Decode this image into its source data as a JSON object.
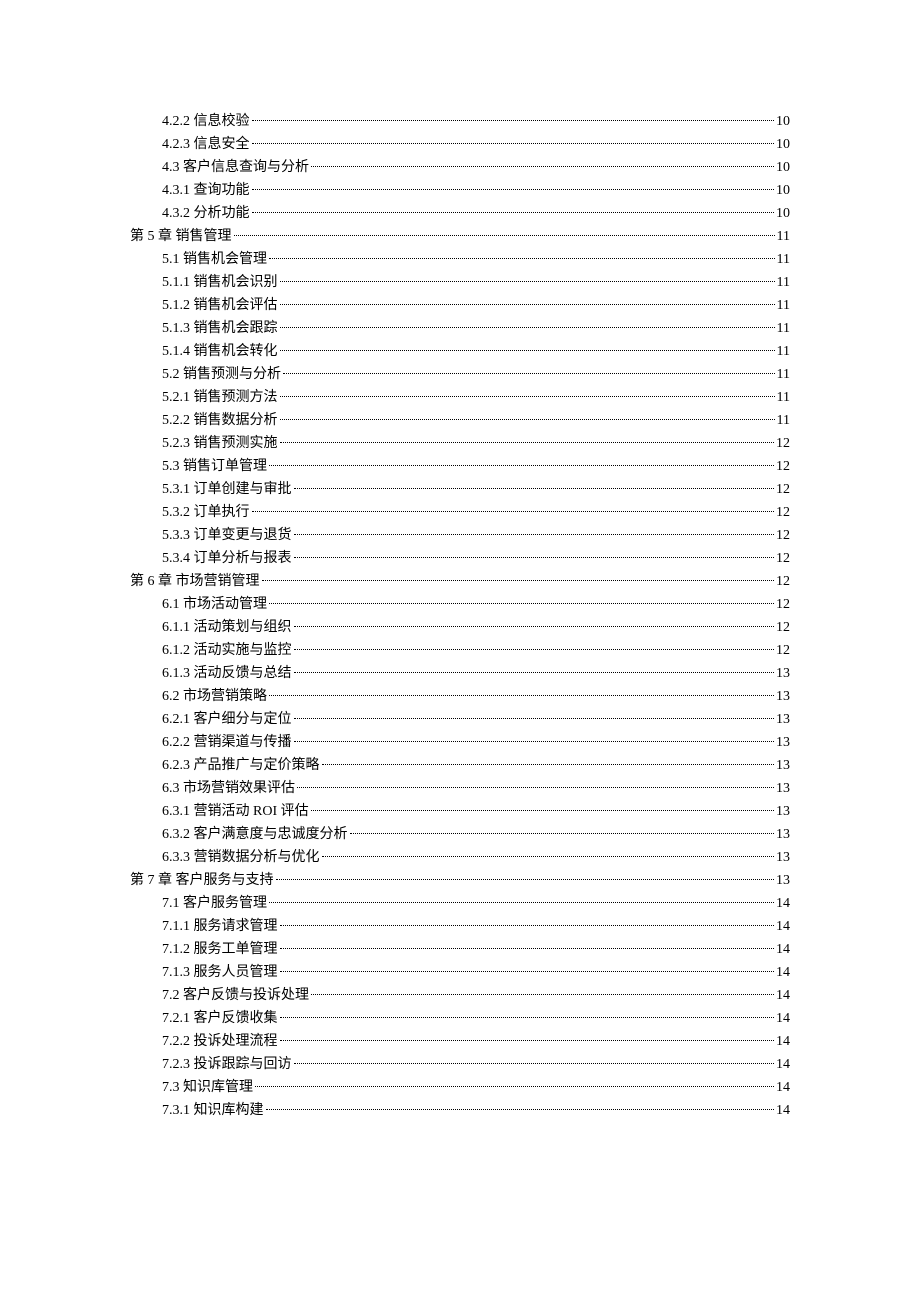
{
  "toc": [
    {
      "level": 1,
      "title": "4.2.2 信息校验",
      "page": "10"
    },
    {
      "level": 1,
      "title": "4.2.3 信息安全",
      "page": "10"
    },
    {
      "level": 1,
      "title": "4.3 客户信息查询与分析",
      "page": "10"
    },
    {
      "level": 1,
      "title": "4.3.1 查询功能",
      "page": "10"
    },
    {
      "level": 1,
      "title": "4.3.2 分析功能",
      "page": "10"
    },
    {
      "level": 0,
      "title": "第 5 章 销售管理",
      "page": "11"
    },
    {
      "level": 1,
      "title": "5.1 销售机会管理",
      "page": "11"
    },
    {
      "level": 1,
      "title": "5.1.1 销售机会识别",
      "page": "11"
    },
    {
      "level": 1,
      "title": "5.1.2 销售机会评估",
      "page": "11"
    },
    {
      "level": 1,
      "title": "5.1.3 销售机会跟踪",
      "page": "11"
    },
    {
      "level": 1,
      "title": "5.1.4 销售机会转化",
      "page": "11"
    },
    {
      "level": 1,
      "title": "5.2 销售预测与分析",
      "page": "11"
    },
    {
      "level": 1,
      "title": "5.2.1 销售预测方法",
      "page": "11"
    },
    {
      "level": 1,
      "title": "5.2.2 销售数据分析",
      "page": "11"
    },
    {
      "level": 1,
      "title": "5.2.3 销售预测实施",
      "page": "12"
    },
    {
      "level": 1,
      "title": "5.3 销售订单管理",
      "page": "12"
    },
    {
      "level": 1,
      "title": "5.3.1 订单创建与审批",
      "page": "12"
    },
    {
      "level": 1,
      "title": "5.3.2 订单执行",
      "page": "12"
    },
    {
      "level": 1,
      "title": "5.3.3 订单变更与退货",
      "page": "12"
    },
    {
      "level": 1,
      "title": "5.3.4 订单分析与报表",
      "page": "12"
    },
    {
      "level": 0,
      "title": "第 6 章 市场营销管理",
      "page": "12"
    },
    {
      "level": 1,
      "title": "6.1 市场活动管理",
      "page": "12"
    },
    {
      "level": 1,
      "title": "6.1.1 活动策划与组织",
      "page": "12"
    },
    {
      "level": 1,
      "title": "6.1.2 活动实施与监控",
      "page": "12"
    },
    {
      "level": 1,
      "title": "6.1.3 活动反馈与总结",
      "page": "13"
    },
    {
      "level": 1,
      "title": "6.2 市场营销策略",
      "page": "13"
    },
    {
      "level": 1,
      "title": "6.2.1 客户细分与定位",
      "page": "13"
    },
    {
      "level": 1,
      "title": "6.2.2 营销渠道与传播",
      "page": "13"
    },
    {
      "level": 1,
      "title": "6.2.3 产品推广与定价策略",
      "page": "13"
    },
    {
      "level": 1,
      "title": "6.3 市场营销效果评估",
      "page": "13"
    },
    {
      "level": 1,
      "title": "6.3.1 营销活动 ROI 评估",
      "page": "13"
    },
    {
      "level": 1,
      "title": "6.3.2 客户满意度与忠诚度分析",
      "page": "13"
    },
    {
      "level": 1,
      "title": "6.3.3 营销数据分析与优化",
      "page": "13"
    },
    {
      "level": 0,
      "title": "第 7 章 客户服务与支持",
      "page": "13"
    },
    {
      "level": 1,
      "title": "7.1 客户服务管理",
      "page": "14"
    },
    {
      "level": 1,
      "title": "7.1.1 服务请求管理",
      "page": "14"
    },
    {
      "level": 1,
      "title": "7.1.2 服务工单管理",
      "page": "14"
    },
    {
      "level": 1,
      "title": "7.1.3 服务人员管理",
      "page": "14"
    },
    {
      "level": 1,
      "title": "7.2 客户反馈与投诉处理",
      "page": "14"
    },
    {
      "level": 1,
      "title": "7.2.1 客户反馈收集",
      "page": "14"
    },
    {
      "level": 1,
      "title": "7.2.2 投诉处理流程",
      "page": "14"
    },
    {
      "level": 1,
      "title": "7.2.3 投诉跟踪与回访",
      "page": "14"
    },
    {
      "level": 1,
      "title": "7.3 知识库管理",
      "page": "14"
    },
    {
      "level": 1,
      "title": "7.3.1 知识库构建",
      "page": "14"
    }
  ]
}
